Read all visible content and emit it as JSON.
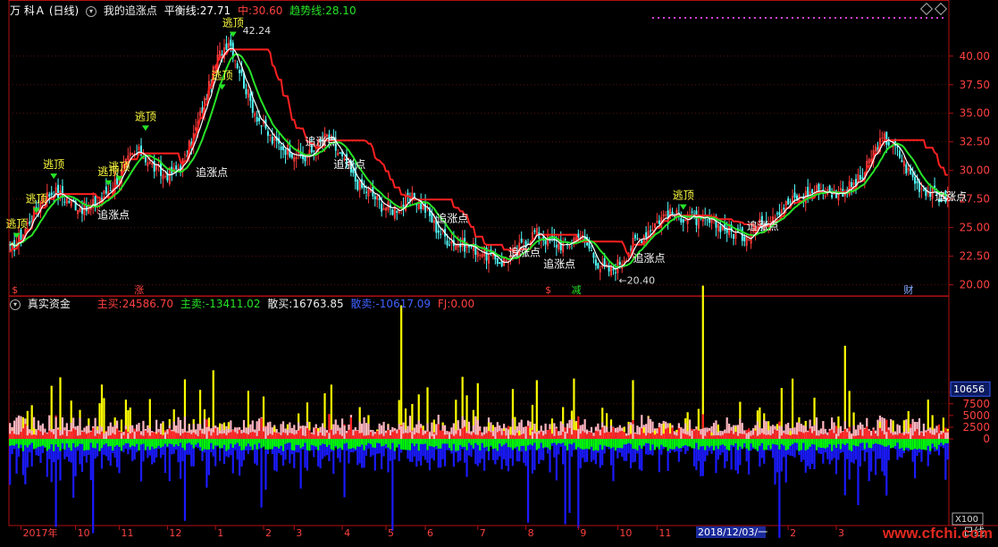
{
  "header": {
    "stock_name": "万 科Ａ",
    "period": "(日线)",
    "indicator_name": "我的追涨点",
    "balance_label": "平衡线:",
    "balance_value": "27.71",
    "mid_label": "中:",
    "mid_value": "30.60",
    "trend_label": "趋势线:",
    "trend_value": "28.10"
  },
  "sub_header": {
    "indicator_name": "真实资金",
    "main_buy_label": "主买:",
    "main_buy_value": "24586.70",
    "main_sell_label": "主卖:",
    "main_sell_value": "-13411.02",
    "retail_buy_label": "散买:",
    "retail_buy_value": "16763.85",
    "retail_sell_label": "散卖:",
    "retail_sell_value": "-10617.09",
    "fj_label": "FJ:",
    "fj_value": "0.00"
  },
  "colors": {
    "background": "#000000",
    "border": "#b01010",
    "up_candle": "#ff3b3b",
    "down_candle": "#54ffff",
    "balance_line": "#ffffff",
    "trend_line": "#27e327",
    "mid_line": "#ff2020",
    "main_buy": "#ffff00",
    "retail_buy": "#ffb6c1",
    "red_bar": "#ff2020",
    "main_sell": "#00ff00",
    "retail_sell": "#1a1aff",
    "header_red": "#ff4040",
    "header_green": "#27e327",
    "header_blue": "#4060ff",
    "label_yellow": "#ffff40"
  },
  "chart_data": [
    {
      "type": "candlestick",
      "title": "我的追涨点",
      "ylim": [
        19.5,
        43.5
      ],
      "y_ticks": [
        "40.00",
        "37.50",
        "35.00",
        "32.50",
        "30.00",
        "27.50",
        "25.00",
        "22.50",
        "20.00"
      ],
      "y_tick_values": [
        40,
        37.5,
        35,
        32.5,
        30,
        27.5,
        25,
        22.5,
        20
      ],
      "high_label": "42.24",
      "low_label": "20.40",
      "close_path": [
        [
          0,
          23.0
        ],
        [
          5,
          24.2
        ],
        [
          10,
          26.0
        ],
        [
          15,
          27.6
        ],
        [
          20,
          28.2
        ],
        [
          25,
          27.6
        ],
        [
          30,
          27.0
        ],
        [
          35,
          26.6
        ],
        [
          40,
          27.3
        ],
        [
          45,
          28.3
        ],
        [
          50,
          29.5
        ],
        [
          55,
          31.2
        ],
        [
          60,
          31.6
        ],
        [
          65,
          30.4
        ],
        [
          70,
          29.6
        ],
        [
          75,
          29.8
        ],
        [
          80,
          31.0
        ],
        [
          85,
          33.6
        ],
        [
          90,
          36.6
        ],
        [
          95,
          39.8
        ],
        [
          100,
          41.5
        ],
        [
          105,
          38.8
        ],
        [
          110,
          36.0
        ],
        [
          115,
          34.0
        ],
        [
          120,
          32.6
        ],
        [
          125,
          32.0
        ],
        [
          130,
          31.6
        ],
        [
          135,
          31.0
        ],
        [
          140,
          32.0
        ],
        [
          145,
          33.0
        ],
        [
          150,
          31.6
        ],
        [
          155,
          30.0
        ],
        [
          160,
          28.6
        ],
        [
          165,
          28.0
        ],
        [
          170,
          27.0
        ],
        [
          175,
          26.6
        ],
        [
          180,
          27.0
        ],
        [
          185,
          27.6
        ],
        [
          190,
          26.6
        ],
        [
          195,
          25.0
        ],
        [
          200,
          24.0
        ],
        [
          205,
          23.6
        ],
        [
          210,
          23.4
        ],
        [
          215,
          23.0
        ],
        [
          220,
          22.4
        ],
        [
          225,
          22.0
        ],
        [
          230,
          22.6
        ],
        [
          235,
          23.6
        ],
        [
          240,
          24.6
        ],
        [
          245,
          24.0
        ],
        [
          250,
          23.6
        ],
        [
          255,
          23.4
        ],
        [
          260,
          24.6
        ],
        [
          265,
          23.2
        ],
        [
          270,
          21.6
        ],
        [
          275,
          21.2
        ],
        [
          280,
          22.2
        ],
        [
          285,
          23.6
        ],
        [
          290,
          24.4
        ],
        [
          295,
          25.4
        ],
        [
          300,
          26.2
        ],
        [
          305,
          26.0
        ],
        [
          310,
          26.0
        ],
        [
          315,
          25.6
        ],
        [
          320,
          25.4
        ],
        [
          325,
          25.2
        ],
        [
          330,
          24.6
        ],
        [
          335,
          24.2
        ],
        [
          340,
          24.8
        ],
        [
          345,
          25.6
        ],
        [
          350,
          26.4
        ],
        [
          355,
          27.0
        ],
        [
          360,
          27.6
        ],
        [
          365,
          28.0
        ],
        [
          370,
          28.4
        ],
        [
          375,
          28.0
        ],
        [
          380,
          28.2
        ],
        [
          385,
          28.6
        ],
        [
          390,
          29.4
        ],
        [
          395,
          31.6
        ],
        [
          400,
          32.8
        ],
        [
          405,
          32.0
        ],
        [
          410,
          30.2
        ],
        [
          415,
          28.8
        ],
        [
          420,
          28.2
        ],
        [
          425,
          27.6
        ]
      ],
      "signals": [
        {
          "text": "逃顶",
          "bar": 3,
          "price": 25.0
        },
        {
          "text": "逃顶",
          "bar": 12,
          "price": 27.2
        },
        {
          "text": "逃顶",
          "bar": 20,
          "price": 30.2
        },
        {
          "text": "逃顶",
          "bar": 45,
          "price": 29.6
        },
        {
          "text": "逃顶",
          "bar": 50,
          "price": 30.0
        },
        {
          "text": "逃顶",
          "bar": 62,
          "price": 34.4
        },
        {
          "text": "逃顶",
          "bar": 97,
          "price": 38.0
        },
        {
          "text": "逃顶",
          "bar": 102,
          "price": 42.6
        },
        {
          "text": "逃顶",
          "bar": 308,
          "price": 27.5
        },
        {
          "text": "追涨点",
          "bar": 40,
          "price": 25.8
        },
        {
          "text": "追涨点",
          "bar": 85,
          "price": 29.5
        },
        {
          "text": "追涨点",
          "bar": 135,
          "price": 32.2
        },
        {
          "text": "追涨点",
          "bar": 148,
          "price": 30.2
        },
        {
          "text": "追涨点",
          "bar": 195,
          "price": 25.5
        },
        {
          "text": "追涨点",
          "bar": 228,
          "price": 22.5
        },
        {
          "text": "追涨点",
          "bar": 244,
          "price": 21.5
        },
        {
          "text": "追涨点",
          "bar": 285,
          "price": 22.0
        },
        {
          "text": "追涨点",
          "bar": 337,
          "price": 24.8
        },
        {
          "text": "追涨点",
          "bar": 423,
          "price": 27.4
        }
      ],
      "markers": [
        {
          "text": "$",
          "bar": 0,
          "color": "#ff4040"
        },
        {
          "text": "涨",
          "bar": 56,
          "color": "#ff4040"
        },
        {
          "text": "$",
          "bar": 244,
          "color": "#ff4040"
        },
        {
          "text": "减",
          "bar": 256,
          "color": "#27e327"
        },
        {
          "text": "财",
          "bar": 408,
          "color": "#88aaff"
        }
      ]
    },
    {
      "type": "bar",
      "title": "真实资金",
      "ylim": [
        -18500,
        27500
      ],
      "y_ticks": [
        "10000",
        "7500",
        "5000",
        "2500",
        "0"
      ],
      "y_tick_values": [
        10000,
        7500,
        5000,
        2500,
        0
      ],
      "current_value": "10656",
      "scale_label": "X100",
      "series": [
        {
          "name": "主买",
          "color": "#ffff00"
        },
        {
          "name": "主卖",
          "color": "#00ff00"
        },
        {
          "name": "散买",
          "color": "#ffb6c1"
        },
        {
          "name": "散卖",
          "color": "#1a1aff"
        }
      ]
    }
  ],
  "x_axis": {
    "labels": [
      {
        "text": "2017年",
        "bar": 5
      },
      {
        "text": "10",
        "bar": 30
      },
      {
        "text": "11",
        "bar": 50
      },
      {
        "text": "12",
        "bar": 72
      },
      {
        "text": "1",
        "bar": 94
      },
      {
        "text": "2",
        "bar": 116
      },
      {
        "text": "3",
        "bar": 130
      },
      {
        "text": "4",
        "bar": 152
      },
      {
        "text": "5",
        "bar": 172
      },
      {
        "text": "6",
        "bar": 190
      },
      {
        "text": "7",
        "bar": 214
      },
      {
        "text": "8",
        "bar": 236
      },
      {
        "text": "9",
        "bar": 260
      },
      {
        "text": "10",
        "bar": 278
      },
      {
        "text": "11",
        "bar": 296
      },
      {
        "text": "2",
        "bar": 356
      },
      {
        "text": "3",
        "bar": 378
      }
    ],
    "cursor_date": "2018/12/03/一",
    "period_label": "日线"
  },
  "watermark": "www.cfchi.com"
}
